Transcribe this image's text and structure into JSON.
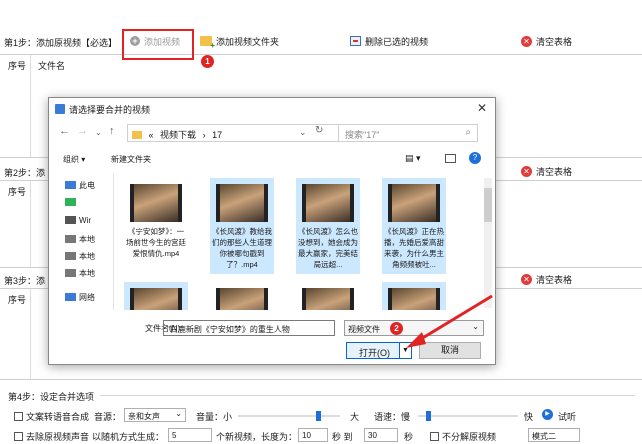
{
  "step1": {
    "label": "第1步：添加原视频【必选】",
    "add_video": "添加视频",
    "add_folder": "添加视频文件夹",
    "delete_selected": "删除已选的视频",
    "clear_table": "清空表格",
    "col_index": "序号",
    "col_filename": "文件名"
  },
  "step2": {
    "label": "第2步：添",
    "clear_table": "清空表格",
    "col_index": "序号"
  },
  "step3": {
    "label": "第3步：添",
    "clear_table": "清空表格",
    "col_index": "序号"
  },
  "badges": {
    "one": "1",
    "two": "2"
  },
  "dialog": {
    "title": "请选择要合并的视频",
    "address_parts": [
      "«",
      "视频下载",
      "›",
      "17"
    ],
    "search_placeholder": "搜索\"17\"",
    "organize": "组织 ▾",
    "new_folder": "新建文件夹",
    "nav_items": [
      "此电",
      "Wir",
      "本地",
      "本地",
      "本地",
      "网络"
    ],
    "files": [
      {
        "name": "《宁安如梦》：一场前世今生的宫廷爱恨情仇.mp4",
        "selected": false
      },
      {
        "name": "《长风渡》教给我们的那些人生道理你被哪句戳到了？.mp4",
        "selected": true
      },
      {
        "name": "《长风渡》怎么也没想到，她会成为最大赢家，完美结局远超...",
        "selected": true
      },
      {
        "name": "《长风渡》正在热播，先婚后爱高甜来袭，为什么男主角频频被吐...",
        "selected": true
      }
    ],
    "filename_label": "文件名(N):",
    "filename_value": "\"白鹿新剧《宁安如梦》的重生人物",
    "filetype": "视频文件",
    "open": "打开(O)",
    "cancel": "取消"
  },
  "step4": {
    "label": "第4步：设定合并选项",
    "tts_label": "文案转语音合成",
    "voice_label": "音源：",
    "voice_value": "亲和女声",
    "volume_label": "音量：小",
    "volume_big": "大",
    "speed_label": "语速：慢",
    "speed_fast": "快",
    "listen": "试听",
    "row2_cb": "去除原视频声音",
    "row2_text": "以随机方式生成：",
    "row2_value": "5",
    "row2_unit": "个新视频，长度为：",
    "len_from": "10",
    "sec": "秒 到",
    "len_to": "30",
    "sec2": "秒",
    "no_split": "不分解原视频",
    "mode": "模式二"
  },
  "colors": {
    "highlight": "#e02424",
    "selected_file": "#cce8ff",
    "accent": "#1e6fd9"
  }
}
